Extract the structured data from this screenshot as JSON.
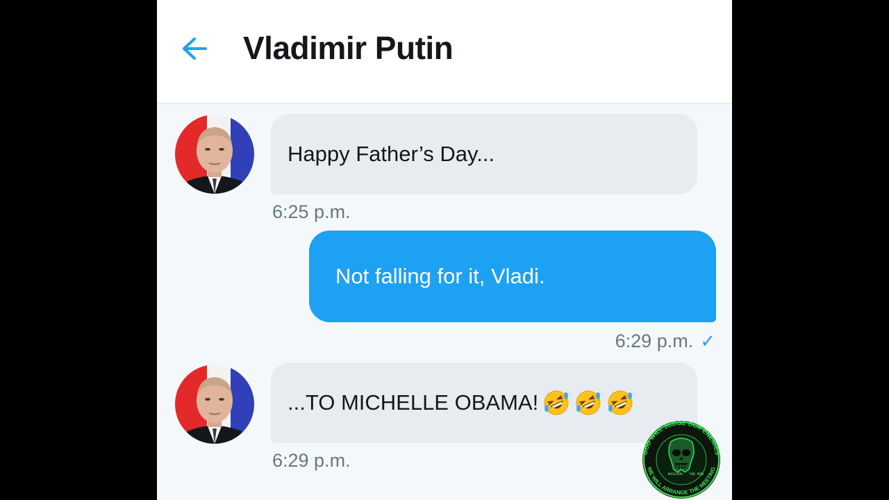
{
  "header": {
    "title": "Vladimir Putin",
    "back_icon": "arrow-left-icon"
  },
  "colors": {
    "accent": "#1da1f2",
    "incoming_bubble": "#e6ecf0",
    "outgoing_bubble": "#1da1f2",
    "timestamp": "#657786",
    "background": "#f5f8fa"
  },
  "messages": [
    {
      "direction": "incoming",
      "text": "Happy Father’s Day...",
      "time": "6:25 p.m."
    },
    {
      "direction": "outgoing",
      "text": "Not falling for it, Vladi.",
      "time": "6:29 p.m.",
      "read_icon": "checkmark-icon"
    },
    {
      "direction": "incoming",
      "text": "...TO MICHELLE OBAMA!",
      "emoji": [
        "rolling-on-floor-laughing",
        "rolling-on-floor-laughing",
        "rolling-on-floor-laughing"
      ],
      "time": "6:29 p.m."
    }
  ],
  "watermark": {
    "ring_text": "GOD WILL JUDGE OUR ENEMIES ★ WE WILL ARRANGE THE MEETING ★",
    "inner_text": "BACKING THE MOB"
  }
}
